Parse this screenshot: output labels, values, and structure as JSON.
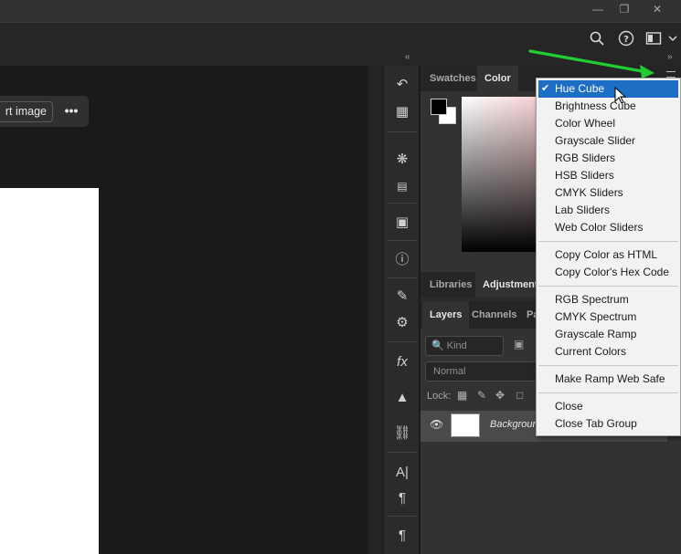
{
  "window": {
    "minimize_icon": "minimize-icon",
    "restore_icon": "restore-icon",
    "close_icon": "close-icon"
  },
  "options_bar": {
    "icons": [
      "search-icon",
      "help-icon",
      "workspace-icon",
      "chevron-down-icon"
    ]
  },
  "document": {
    "export_button_label": "rt image",
    "more_button_label": "•••"
  },
  "panel_tabs_top": [
    "Swatches",
    "Color"
  ],
  "panel_tabs_mid": [
    "Libraries",
    "Adjustments"
  ],
  "panel_tabs_layers": [
    "Layers",
    "Channels",
    "Pa"
  ],
  "layers": {
    "kind_placeholder": "Kind",
    "blend_mode": "Normal",
    "lock_label": "Lock:",
    "layer_name": "Background"
  },
  "colors": {
    "menu_highlight": "#1d6ec5",
    "annotation_arrow": "#22cc33",
    "foreground": "#000000",
    "background": "#ffffff"
  },
  "menu": {
    "groups": [
      [
        "Hue Cube",
        "Brightness Cube",
        "Color Wheel",
        "Grayscale Slider",
        "RGB Sliders",
        "HSB Sliders",
        "CMYK Sliders",
        "Lab Sliders",
        "Web Color Sliders"
      ],
      [
        "Copy Color as HTML",
        "Copy Color's Hex Code"
      ],
      [
        "RGB Spectrum",
        "CMYK Spectrum",
        "Grayscale Ramp",
        "Current Colors"
      ],
      [
        "Make Ramp Web Safe"
      ],
      [
        "Close",
        "Close Tab Group"
      ]
    ],
    "selected": "Hue Cube"
  }
}
